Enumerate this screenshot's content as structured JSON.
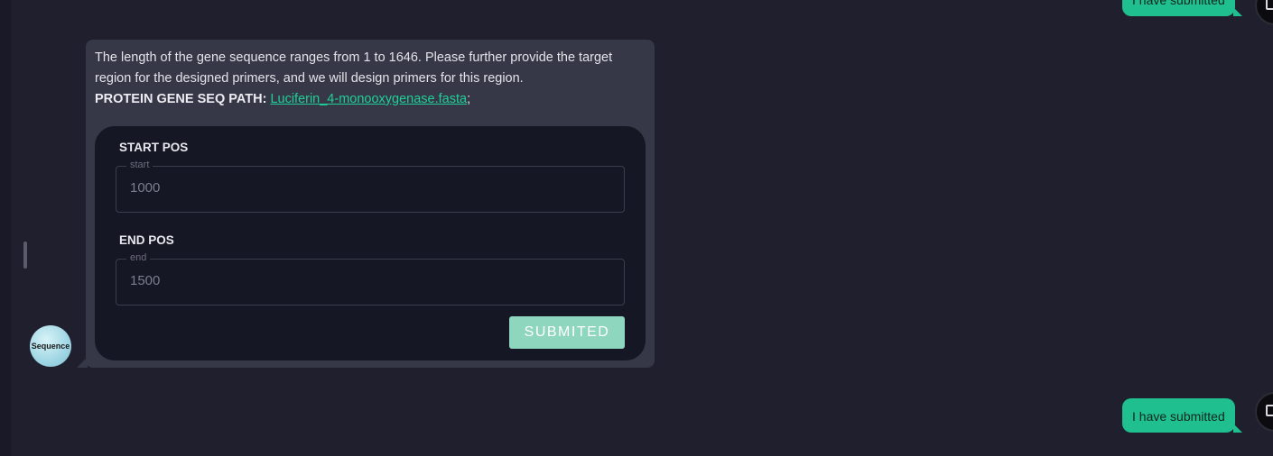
{
  "chat": {
    "user_messages": [
      "I have submitted",
      "I have submitted"
    ],
    "bot_avatar_label": "Sequence",
    "bot_message": {
      "text_line1": "The length of the gene sequence ranges from 1 to 1646. Please further provide the target",
      "text_line2": "region for the designed primers, and we will design primers for this region.",
      "path_label": "PROTEIN GENE SEQ PATH:",
      "path_link": "Luciferin_4-monooxygenase.fasta",
      "path_suffix": ";"
    },
    "form": {
      "start": {
        "label": "START POS",
        "legend": "start",
        "value": "1000"
      },
      "end": {
        "label": "END POS",
        "legend": "end",
        "value": "1500"
      },
      "submit_label": "SUBMITED"
    }
  },
  "colors": {
    "background": "#1f1f2e",
    "bot_bubble": "#373847",
    "form_card": "#161725",
    "user_bubble": "#1fbf8f",
    "link": "#1fcf98",
    "submit_button": "#8fd6bf"
  },
  "icons": {
    "user_avatar": "monitor-icon",
    "bot_avatar": "sequence-avatar"
  }
}
